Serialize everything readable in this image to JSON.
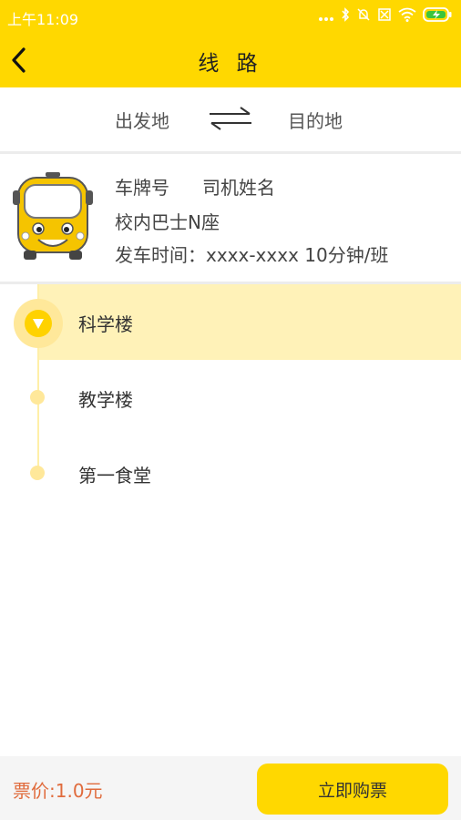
{
  "status_bar": {
    "time": "上午11:09",
    "icons": [
      "more-dots-icon",
      "bluetooth-icon",
      "bell-off-icon",
      "sim-off-icon",
      "wifi-icon",
      "battery-charging-icon"
    ]
  },
  "header": {
    "title": "线 路",
    "back_icon": "chevron-left-icon"
  },
  "route": {
    "from_label": "出发地",
    "to_label": "目的地",
    "swap_icon": "swap-arrows-icon"
  },
  "bus": {
    "plate_label": "车牌号",
    "driver_label": "司机姓名",
    "bus_name": "校内巴士N座",
    "departure": "发车时间：xxxx-xxxx  10分钟/班"
  },
  "stops": [
    {
      "name": "科学楼",
      "active": true
    },
    {
      "name": "教学楼",
      "active": false
    },
    {
      "name": "第一食堂",
      "active": false
    }
  ],
  "footer": {
    "price": "票价:1.0元",
    "buy_label": "立即购票"
  },
  "colors": {
    "brand_yellow": "#FFD800",
    "active_row": "#FFF2B8",
    "price_orange": "#E06B3C"
  }
}
